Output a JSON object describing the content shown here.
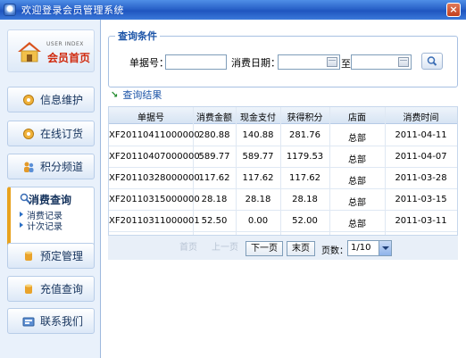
{
  "window": {
    "title": "欢迎登录会员管理系统",
    "close": "×"
  },
  "sidebar": {
    "home": {
      "eng": "USER INDEX",
      "label": "会员首页"
    },
    "items": [
      {
        "label": "信息维护",
        "icon": "gear-icon"
      },
      {
        "label": "在线订货",
        "icon": "gear-icon"
      },
      {
        "label": "积分频道",
        "icon": "people-icon"
      }
    ],
    "active": {
      "label": "消费查询",
      "icon": "search-icon",
      "sub": [
        "消费记录",
        "计次记录"
      ]
    },
    "items_bottom": [
      {
        "label": "预定管理",
        "icon": "cylinder-icon"
      },
      {
        "label": "充值查询",
        "icon": "cylinder-icon"
      },
      {
        "label": "联系我们",
        "icon": "contact-icon"
      }
    ]
  },
  "search": {
    "legend": "查询条件",
    "receipt_label": "单据号：",
    "receipt_value": "",
    "date_label": "消费日期：",
    "date_from": "",
    "date_sep": "至",
    "date_to": ""
  },
  "results": {
    "title": "查询结果",
    "columns": [
      "单据号",
      "消费金额",
      "现金支付",
      "获得积分",
      "店面",
      "消费时间"
    ],
    "rows": [
      [
        "XF20110411000000",
        "280.88",
        "140.88",
        "281.76",
        "总部",
        "2011-04-11"
      ],
      [
        "XF20110407000000",
        "589.77",
        "589.77",
        "1179.53",
        "总部",
        "2011-04-07"
      ],
      [
        "XF20110328000000",
        "117.62",
        "117.62",
        "117.62",
        "总部",
        "2011-03-28"
      ],
      [
        "XF20110315000000",
        "28.18",
        "28.18",
        "28.18",
        "总部",
        "2011-03-15"
      ],
      [
        "XF20110311000001",
        "52.50",
        "0.00",
        "52.00",
        "总部",
        "2011-03-11"
      ]
    ]
  },
  "pager": {
    "first": "首页",
    "prev": "上一页",
    "next": "下一页",
    "last": "末页",
    "pages_label": "页数：",
    "page_value": "1/10"
  },
  "colors": {
    "accent": "#1d55a8",
    "titlebar": "#2a63c9",
    "home_text": "#d02a0e"
  }
}
